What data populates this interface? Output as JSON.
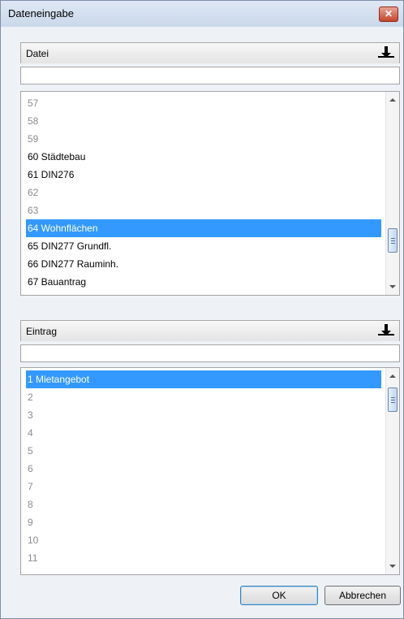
{
  "window": {
    "title": "Dateneingabe",
    "close_label": "✕"
  },
  "datei": {
    "header": "Datei",
    "input_value": "",
    "items": [
      {
        "label": "57",
        "state": "grey"
      },
      {
        "label": "58",
        "state": "grey"
      },
      {
        "label": "59",
        "state": "grey"
      },
      {
        "label": "60 Städtebau",
        "state": "normal"
      },
      {
        "label": "61 DIN276",
        "state": "normal"
      },
      {
        "label": "62",
        "state": "grey"
      },
      {
        "label": "63",
        "state": "grey"
      },
      {
        "label": "64 Wohnflächen",
        "state": "selected"
      },
      {
        "label": "65 DIN277 Grundfl.",
        "state": "normal"
      },
      {
        "label": "66 DIN277 Rauminh.",
        "state": "normal"
      },
      {
        "label": "67 Bauantrag",
        "state": "normal"
      }
    ],
    "scroll_position": 0.82
  },
  "eintrag": {
    "header": "Eintrag",
    "input_value": "",
    "items": [
      {
        "label": "1 Mietangebot",
        "state": "selected"
      },
      {
        "label": "2",
        "state": "grey"
      },
      {
        "label": "3",
        "state": "grey"
      },
      {
        "label": "4",
        "state": "grey"
      },
      {
        "label": "5",
        "state": "grey"
      },
      {
        "label": "6",
        "state": "grey"
      },
      {
        "label": "7",
        "state": "grey"
      },
      {
        "label": "8",
        "state": "grey"
      },
      {
        "label": "9",
        "state": "grey"
      },
      {
        "label": "10",
        "state": "grey"
      },
      {
        "label": "11",
        "state": "grey"
      }
    ],
    "scroll_position": 0.02
  },
  "buttons": {
    "ok": "OK",
    "cancel": "Abbrechen"
  },
  "colors": {
    "selection": "#3399ff",
    "disabled_text": "#8b8b8b"
  }
}
